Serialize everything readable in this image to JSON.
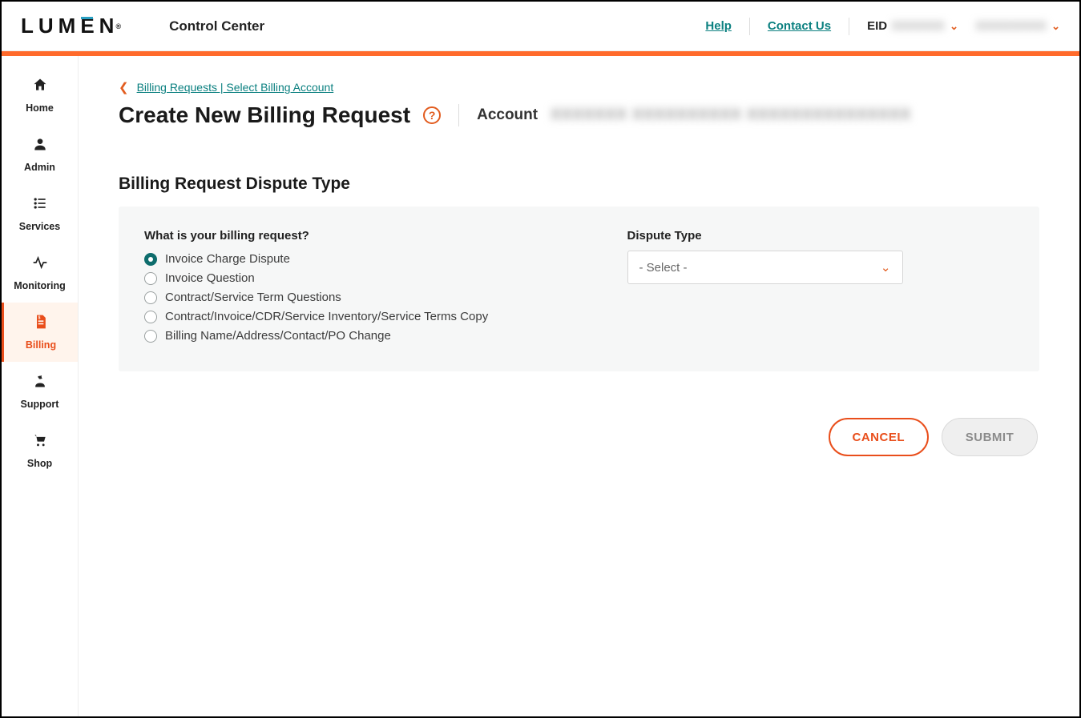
{
  "header": {
    "logo_text": "LUM",
    "logo_text2": "N",
    "regmark": "®",
    "app_title": "Control Center",
    "help": "Help",
    "contact": "Contact Us",
    "eid_label": "EID",
    "eid_value": "XXXXXX",
    "user_value": "XXXXXXXX"
  },
  "sidebar": {
    "items": [
      {
        "label": "Home"
      },
      {
        "label": "Admin"
      },
      {
        "label": "Services"
      },
      {
        "label": "Monitoring"
      },
      {
        "label": "Billing"
      },
      {
        "label": "Support"
      },
      {
        "label": "Shop"
      }
    ]
  },
  "breadcrumb": {
    "text": "Billing Requests | Select Billing Account"
  },
  "page": {
    "title": "Create New Billing Request",
    "account_label": "Account",
    "account_value": "XXXXXXX   XXXXXXXXXX  XXXXXXXXXXXXXXX"
  },
  "section": {
    "title": "Billing Request Dispute Type",
    "question": "What is your billing request?",
    "options": [
      "Invoice Charge Dispute",
      "Invoice Question",
      "Contract/Service Term Questions",
      "Contract/Invoice/CDR/Service Inventory/Service Terms Copy",
      "Billing Name/Address/Contact/PO Change"
    ],
    "selected_index": 0,
    "dispute_label": "Dispute Type",
    "dispute_placeholder": "- Select -"
  },
  "actions": {
    "cancel": "CANCEL",
    "submit": "SUBMIT"
  }
}
